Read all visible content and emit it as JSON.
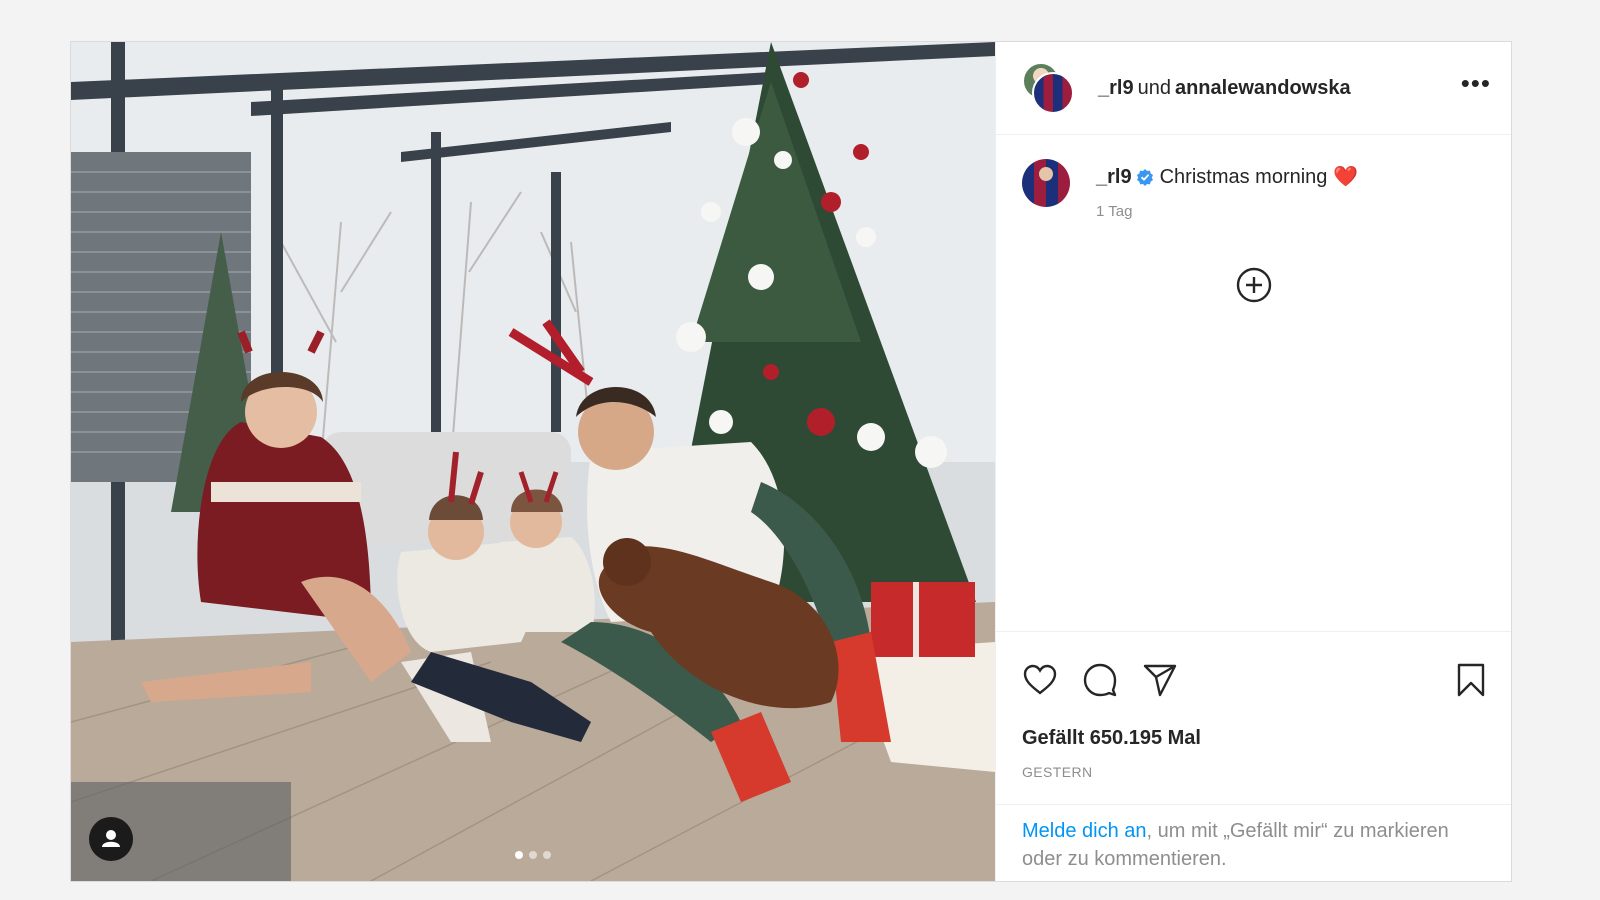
{
  "header": {
    "user1": "_rl9",
    "connector": "und",
    "user2": "annalewandowska",
    "more": "•••"
  },
  "caption": {
    "username": "_rl9",
    "text": "Christmas morning",
    "emoji": "❤️",
    "time": "1 Tag"
  },
  "likes": "Gefällt 650.195 Mal",
  "date": "GESTERN",
  "login": {
    "link": "Melde dich an",
    "rest": ", um mit „Gefällt mir“ zu markieren oder zu kommentieren."
  },
  "carousel": {
    "total": 3,
    "active": 1
  },
  "icons": [
    "heart-icon",
    "comment-icon",
    "share-icon",
    "bookmark-icon",
    "plus-circle-icon",
    "user-tag-icon",
    "verified-icon",
    "more-icon"
  ],
  "colors": {
    "link": "#0095f6",
    "verified": "#3897f0",
    "heart": "#ed4956",
    "muted": "#8e8e8e"
  }
}
